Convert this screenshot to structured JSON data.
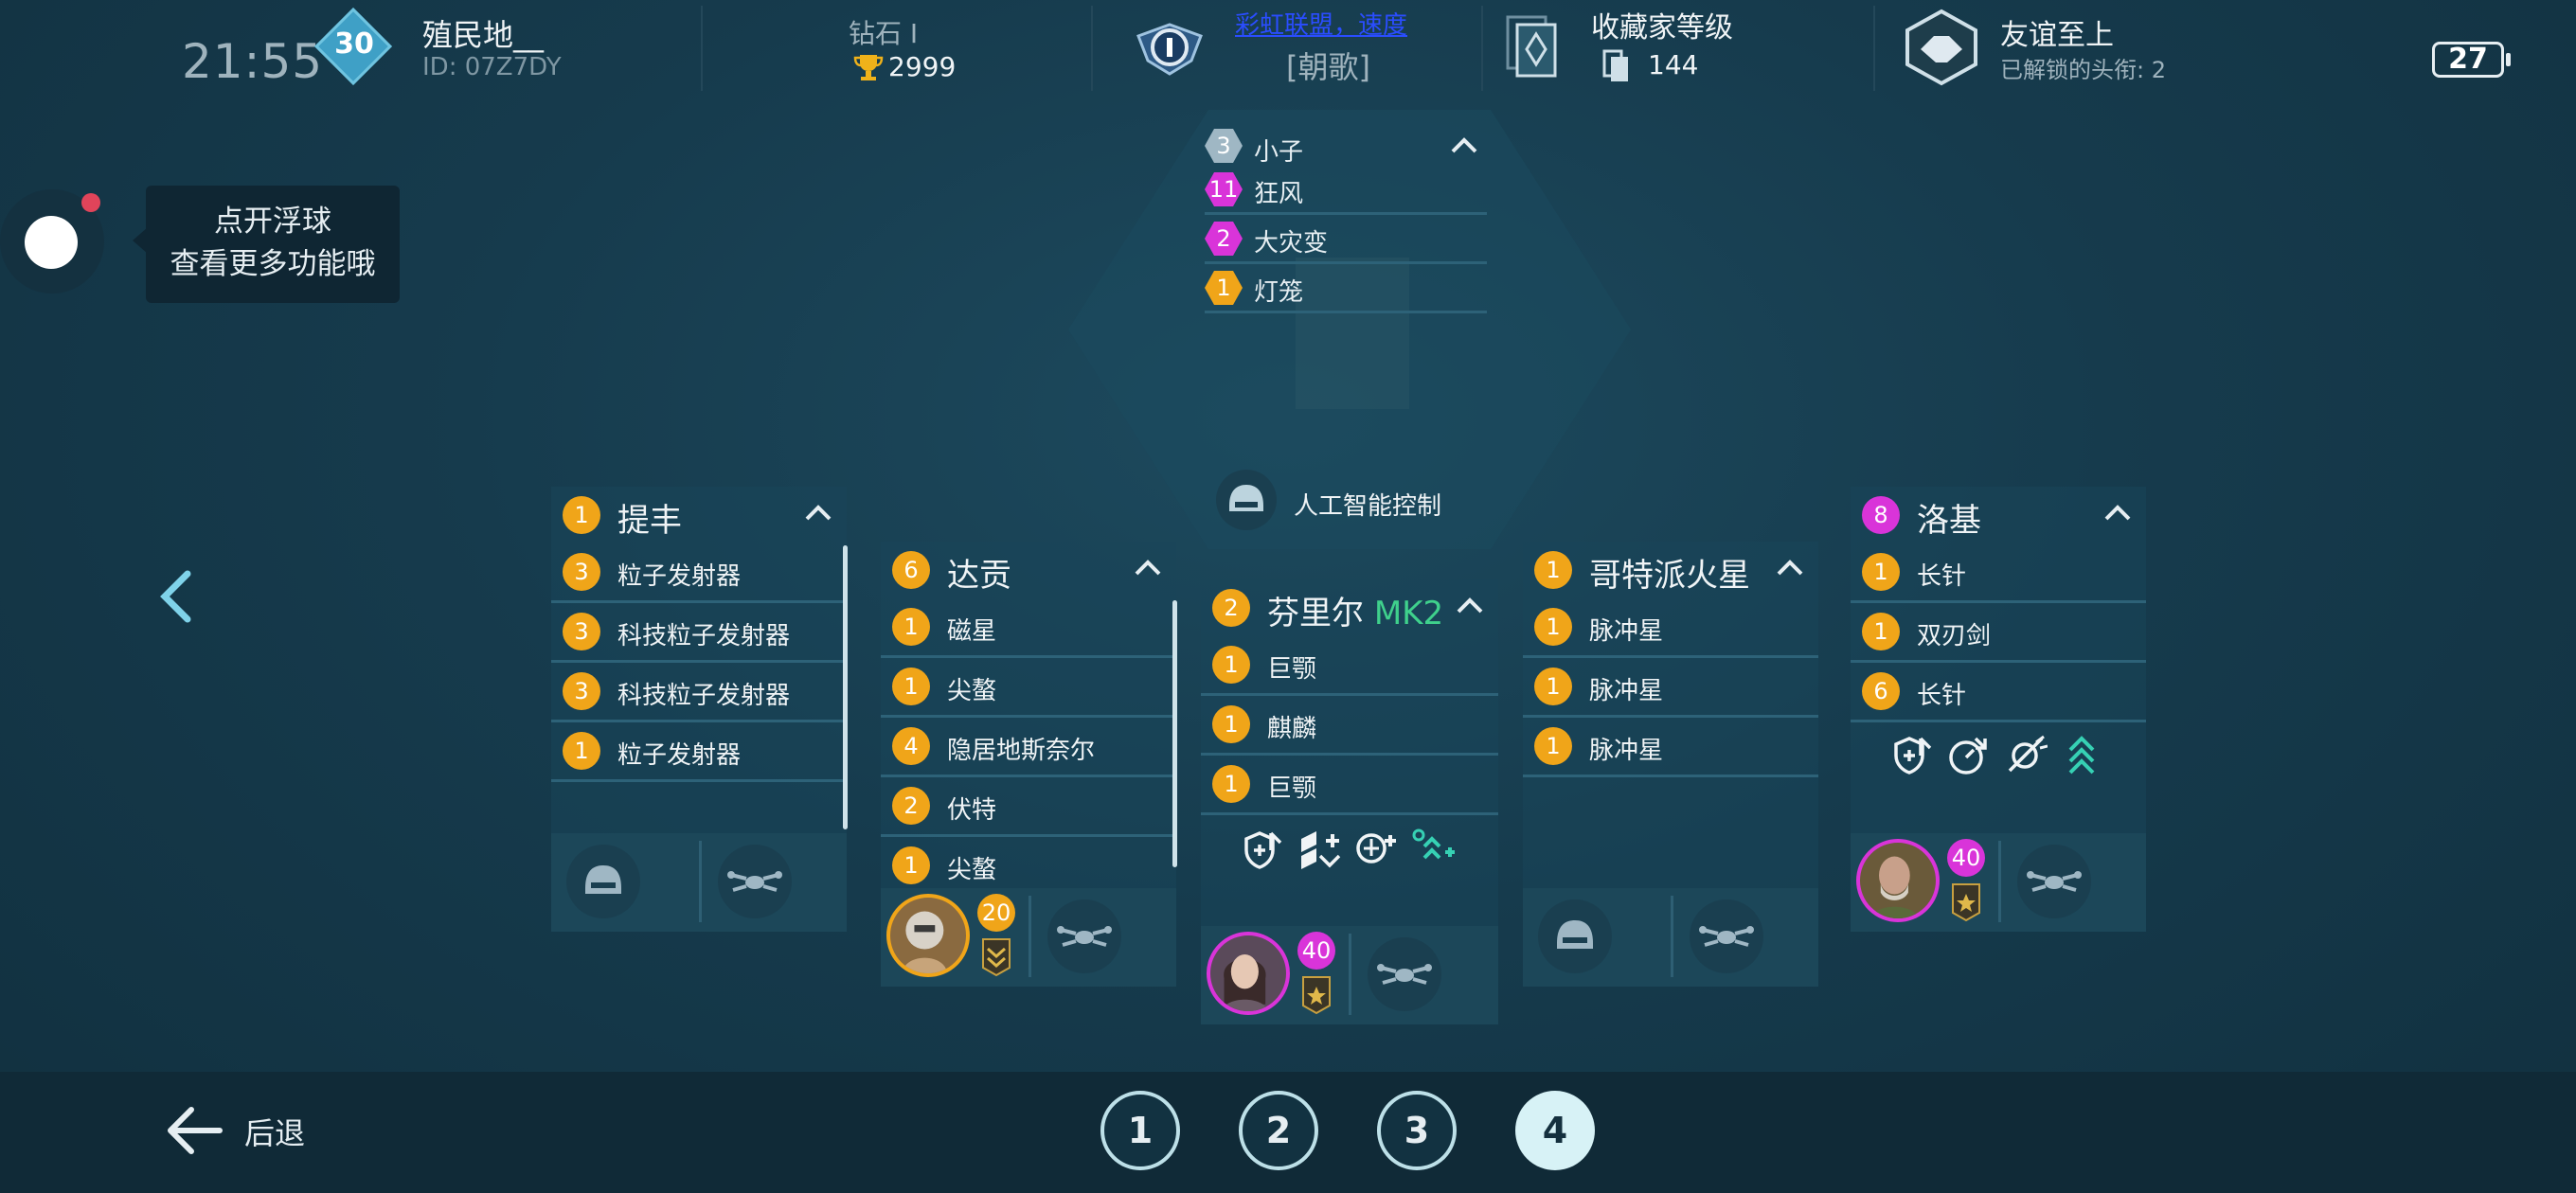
{
  "status": {
    "clock": "21:55",
    "battery": "27"
  },
  "player": {
    "level": "30",
    "name": "殖民地__",
    "id": "ID: 07Z7DY"
  },
  "league": {
    "rank": "钻石 I",
    "trophies": "2999"
  },
  "clan": {
    "name": "彩虹联盟，速度",
    "tag": "[朝歌]"
  },
  "collection": {
    "title": "收藏家等级",
    "value": "144"
  },
  "friendship": {
    "title": "友谊至上",
    "subtitle": "已解锁的头衔:  2"
  },
  "floating_ball": {
    "tip_line1": "点开浮球",
    "tip_line2": "查看更多功能哦"
  },
  "center": {
    "pilot_items": [
      {
        "level": "3",
        "name": "小子",
        "color": "#9fb7c4"
      },
      {
        "level": "11",
        "name": "狂风",
        "color": "#d934d9"
      },
      {
        "level": "2",
        "name": "大灾变",
        "color": "#d934d9"
      },
      {
        "level": "1",
        "name": "灯笼",
        "color": "#f0a519"
      }
    ],
    "ai_label": "人工智能控制"
  },
  "robots": [
    {
      "level": "1",
      "name": "提丰",
      "suffix": "",
      "weapons": [
        {
          "level": "3",
          "name": "粒子发射器"
        },
        {
          "level": "3",
          "name": "科技粒子发射器"
        },
        {
          "level": "3",
          "name": "科技粒子发射器"
        },
        {
          "level": "1",
          "name": "粒子发射器"
        }
      ]
    },
    {
      "level": "6",
      "name": "达贡",
      "suffix": "",
      "weapons": [
        {
          "level": "1",
          "name": "磁星"
        },
        {
          "level": "1",
          "name": "尖螯"
        },
        {
          "level": "4",
          "name": "隐居地斯奈尔"
        },
        {
          "level": "2",
          "name": "伏特"
        },
        {
          "level": "1",
          "name": "尖螯"
        }
      ],
      "pilot_level": "20"
    },
    {
      "level": "2",
      "name": "芬里尔",
      "suffix": "MK2",
      "weapons": [
        {
          "level": "1",
          "name": "巨颚"
        },
        {
          "level": "1",
          "name": "麒麟"
        },
        {
          "level": "1",
          "name": "巨颚"
        }
      ],
      "pilot_level": "40"
    },
    {
      "level": "1",
      "name": "哥特派火星",
      "suffix": "",
      "weapons": [
        {
          "level": "1",
          "name": "脉冲星"
        },
        {
          "level": "1",
          "name": "脉冲星"
        },
        {
          "level": "1",
          "name": "脉冲星"
        }
      ]
    },
    {
      "level": "8",
      "name": "洛基",
      "suffix": "",
      "weapons": [
        {
          "level": "1",
          "name": "长针"
        },
        {
          "level": "1",
          "name": "双刃剑"
        },
        {
          "level": "6",
          "name": "长针"
        }
      ],
      "pilot_level": "40"
    }
  ],
  "bottom": {
    "back_label": "后退",
    "pages": [
      "1",
      "2",
      "3",
      "4"
    ],
    "active_page": "4"
  },
  "colors": {
    "accent": "#d7f2f6",
    "orange": "#f0a519",
    "pink": "#d934d9",
    "mk_green": "#3fd18c"
  }
}
